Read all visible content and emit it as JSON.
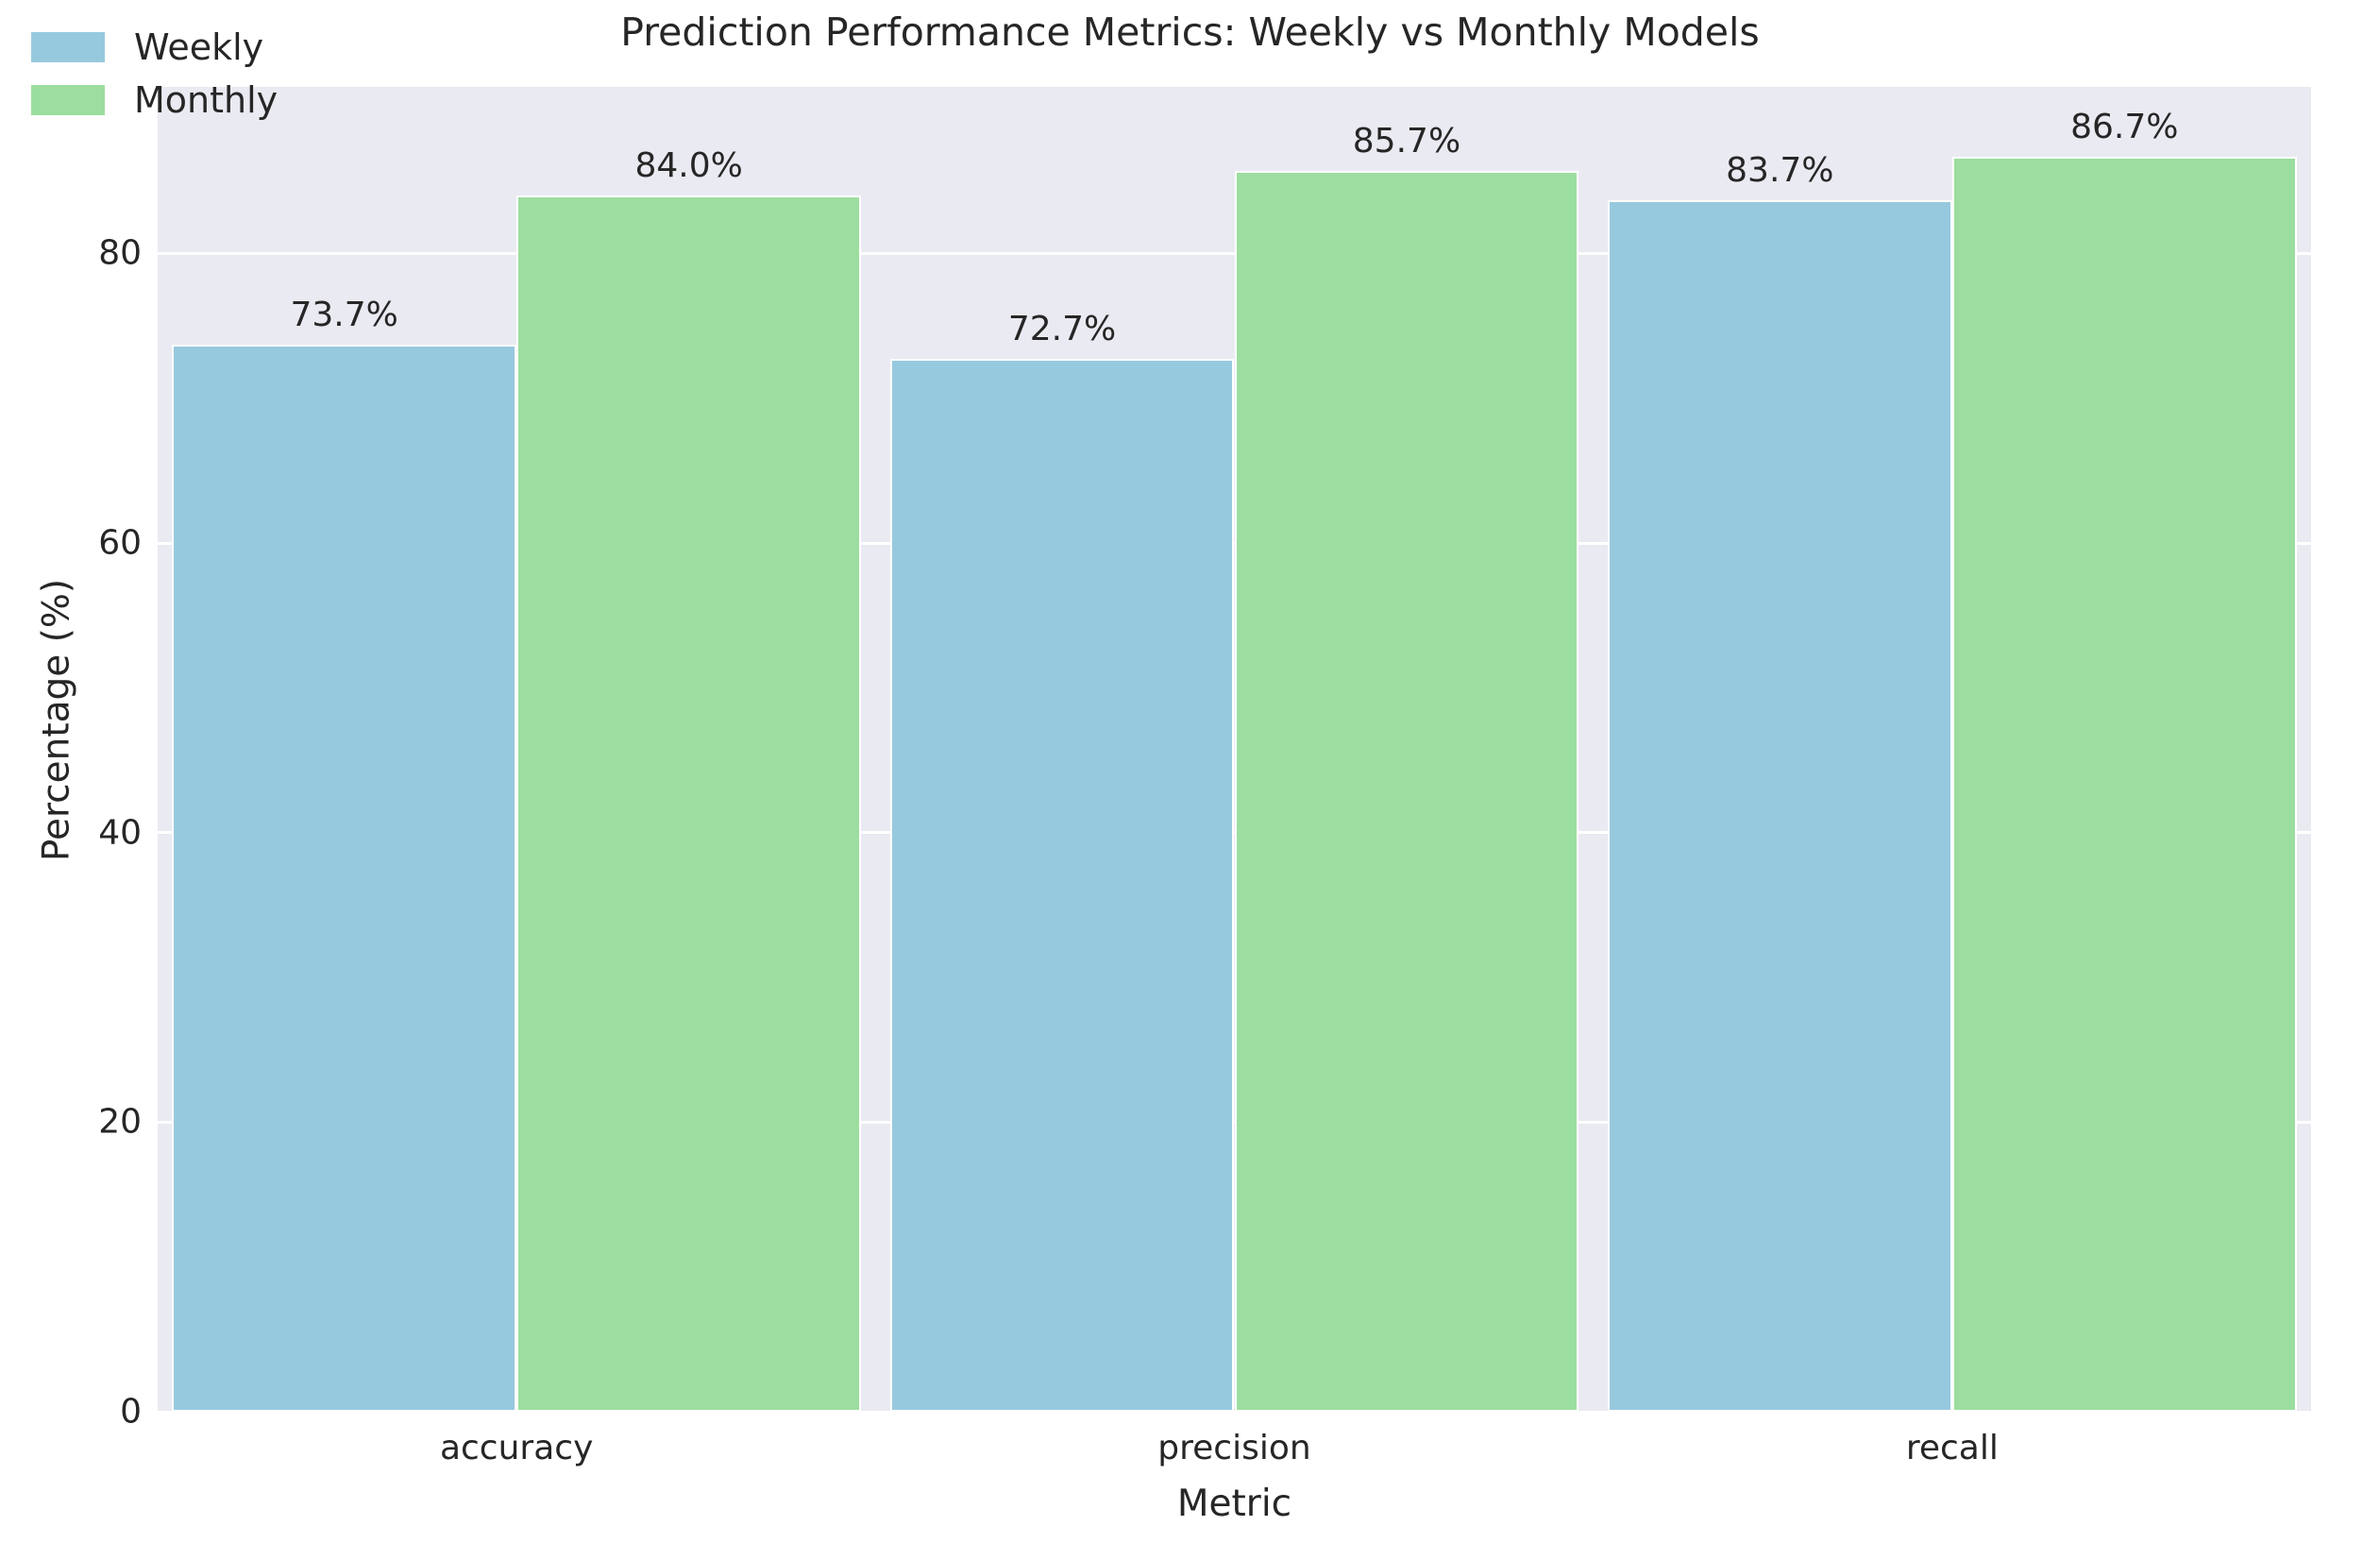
{
  "chart_data": {
    "type": "bar",
    "title": "Prediction Performance Metrics: Weekly vs Monthly Models",
    "xlabel": "Metric",
    "ylabel": "Percentage (%)",
    "categories": [
      "accuracy",
      "precision",
      "recall"
    ],
    "series": [
      {
        "name": "Weekly",
        "color": "#97C9DE",
        "values": [
          73.7,
          72.7,
          83.7
        ],
        "labels": [
          "73.7%",
          "72.7%",
          "83.7%"
        ]
      },
      {
        "name": "Monthly",
        "color": "#9CDE9F",
        "values": [
          84.0,
          85.7,
          86.7
        ],
        "labels": [
          "84.0%",
          "85.7%",
          "86.7%"
        ]
      }
    ],
    "ylim": [
      0,
      91.5
    ],
    "yticks": [
      0,
      20,
      40,
      60,
      80
    ],
    "ytick_labels": [
      "0",
      "20",
      "40",
      "60",
      "80"
    ],
    "grid": true,
    "grid_color": "#ffffff",
    "legend_position": "upper left",
    "plot_background": "#EAEAF2",
    "figure_background": "#ffffff",
    "text_color": "#262626"
  },
  "legend": {
    "entries": [
      {
        "label": "Weekly"
      },
      {
        "label": "Monthly"
      }
    ]
  }
}
